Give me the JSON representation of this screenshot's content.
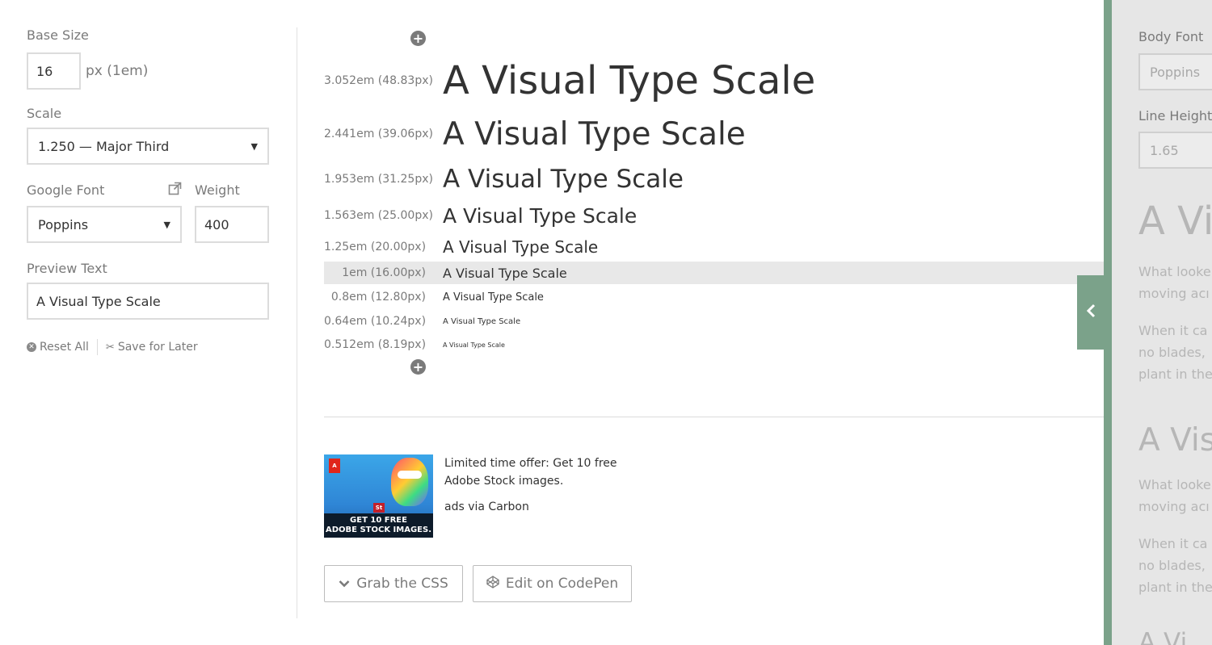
{
  "controls": {
    "base_size": {
      "label": "Base Size",
      "value": "16",
      "unit": "px (1em)"
    },
    "scale": {
      "label": "Scale",
      "selected": "1.250 — Major Third"
    },
    "google_font": {
      "label": "Google Font",
      "selected": "Poppins"
    },
    "weight": {
      "label": "Weight",
      "value": "400"
    },
    "preview_text": {
      "label": "Preview Text",
      "value": "A Visual Type Scale"
    },
    "reset_label": "Reset All",
    "save_label": "Save for Later"
  },
  "scale_rows": [
    {
      "label": "3.052em (48.83px)",
      "text": "A Visual Type Scale"
    },
    {
      "label": "2.441em (39.06px)",
      "text": "A Visual Type Scale"
    },
    {
      "label": "1.953em (31.25px)",
      "text": "A Visual Type Scale"
    },
    {
      "label": "1.563em (25.00px)",
      "text": "A Visual Type Scale"
    },
    {
      "label": "1.25em (20.00px)",
      "text": "A Visual Type Scale"
    },
    {
      "label": "1em (16.00px)",
      "text": "A Visual Type Scale"
    },
    {
      "label": "0.8em (12.80px)",
      "text": "A Visual Type Scale"
    },
    {
      "label": "0.64em (10.24px)",
      "text": "A Visual Type Scale"
    },
    {
      "label": "0.512em (8.19px)",
      "text": "A Visual Type Scale"
    }
  ],
  "ad": {
    "image_logo": "A",
    "image_badge": "St",
    "image_text_1": "GET 10 FREE",
    "image_text_2": "ADOBE STOCK IMAGES.",
    "text": "Limited time offer: Get 10 free Adobe Stock images.",
    "via": "ads via Carbon"
  },
  "buttons": {
    "grab_css": "Grab the CSS",
    "codepen": "Edit on CodePen"
  },
  "preview_panel": {
    "body_font_label": "Body Font",
    "body_font_value": "Poppins",
    "line_height_label": "Line Height",
    "line_height_value": "1.65",
    "heading_1": "A Vi",
    "para_1_line_1": "What looke",
    "para_1_line_2": "moving acı",
    "para_2_line_1": "When it ca",
    "para_2_line_2": "no blades,",
    "para_2_line_3": "plant in the",
    "heading_2": "A Vis",
    "para_3_line_1": "What looke",
    "para_3_line_2": "moving acı",
    "para_4_line_1": "When it ca",
    "para_4_line_2": "no blades,",
    "para_4_line_3": "plant in the",
    "heading_3": "A Vi"
  },
  "colors": {
    "accent_green": "#7ba28a",
    "muted_text": "#7a7a7a",
    "highlight_row": "#e8e8e8"
  }
}
